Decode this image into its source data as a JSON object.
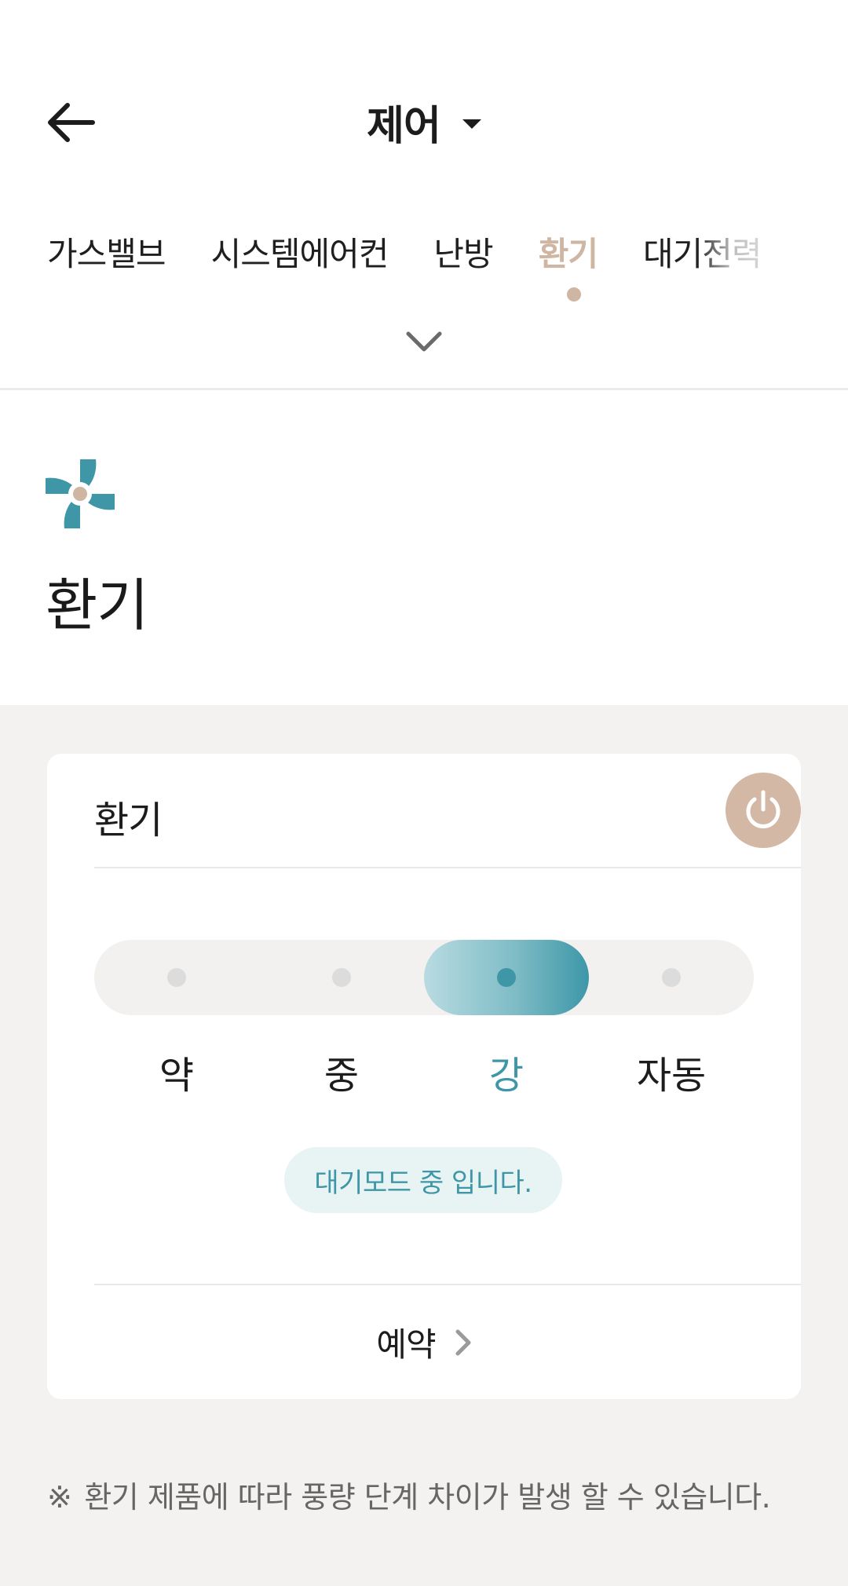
{
  "header": {
    "title": "제어"
  },
  "tabs": [
    {
      "label": "가스밸브",
      "active": false
    },
    {
      "label": "시스템에어컨",
      "active": false
    },
    {
      "label": "난방",
      "active": false
    },
    {
      "label": "환기",
      "active": true
    },
    {
      "label": "대기전력",
      "active": false
    }
  ],
  "page": {
    "title": "환기",
    "icon": "ventilation-fan-icon"
  },
  "card": {
    "title": "환기",
    "power": "power-icon",
    "levels": [
      "약",
      "중",
      "강",
      "자동"
    ],
    "selected_level": "강",
    "status": "대기모드 중 입니다.",
    "reserve_label": "예약"
  },
  "note": {
    "mark": "※",
    "text": "환기 제품에 따라 풍량 단계 차이가 발생 할 수 있습니다."
  },
  "colors": {
    "accent": "#3f96a7",
    "brand": "#cfb6a3",
    "background": "#f3f2f0"
  }
}
